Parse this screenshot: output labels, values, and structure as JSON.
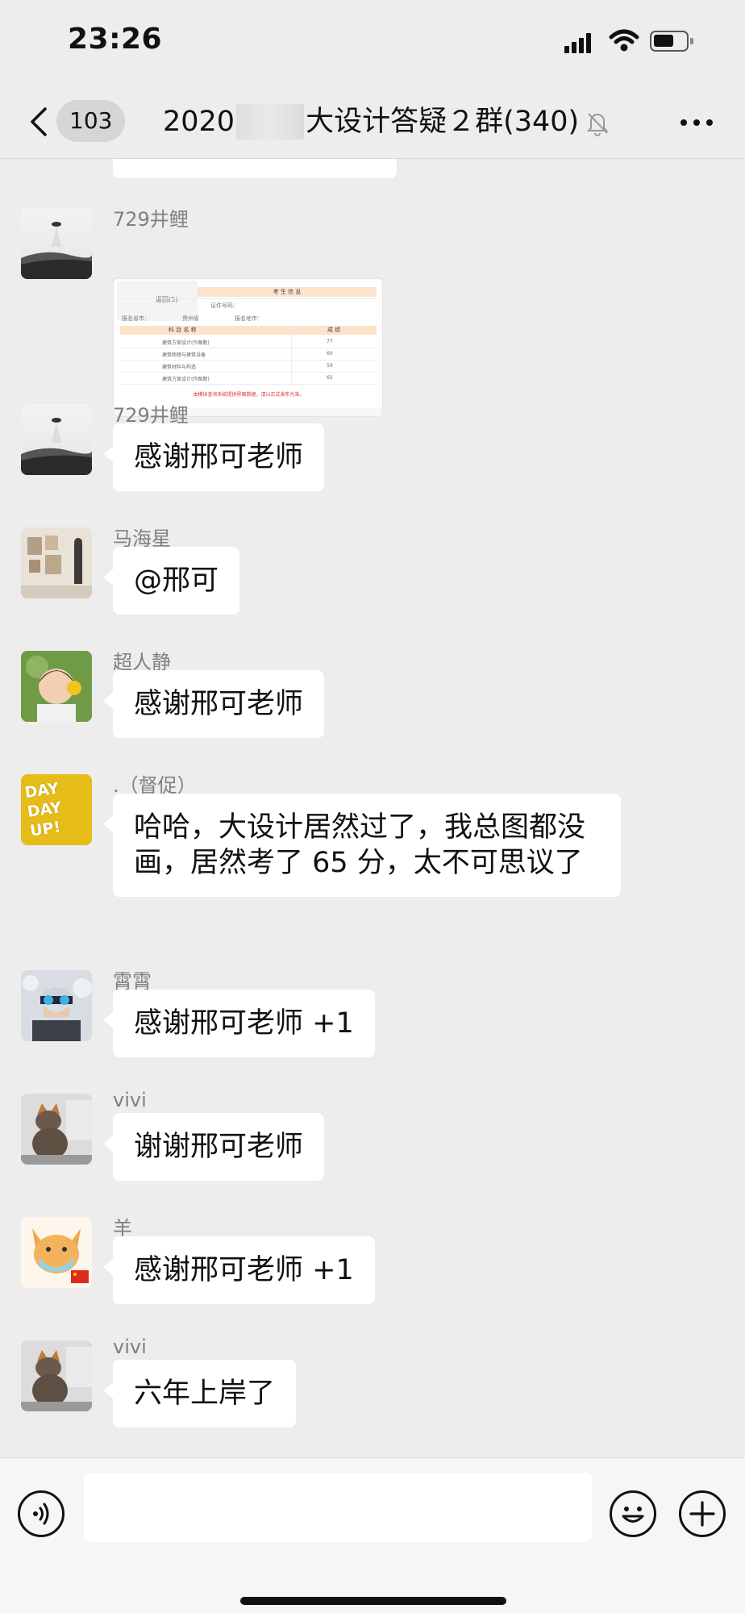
{
  "status_bar": {
    "time": "23:26"
  },
  "nav": {
    "unread_count": "103",
    "title_prefix": "2020",
    "title_suffix": "大设计答疑２群(340)",
    "icons": [
      "back-chevron-icon",
      "muted-bell-icon",
      "more-dots-icon"
    ]
  },
  "messages": [
    {
      "sender": "729井鲤",
      "type": "image",
      "avatar": "ufo-landscape-avatar"
    },
    {
      "sender": "729井鲤",
      "text": "感谢邢可老师",
      "avatar": "ufo-landscape-avatar"
    },
    {
      "sender": "马海星",
      "text": "@邢可",
      "avatar": "gallery-avatar"
    },
    {
      "sender": "超人静",
      "text": "感谢邢可老师",
      "avatar": "child-flower-avatar"
    },
    {
      "sender": ".（督促）",
      "text": "哈哈，大设计居然过了，我总图都没画，居然考了 65 分，太不可思议了",
      "avatar": "day-day-up-avatar",
      "avatar_text": [
        "DAY",
        "DAY",
        "UP!"
      ]
    },
    {
      "sender": "霄霄",
      "text": "感谢邢可老师 +1",
      "avatar": "snow-person-avatar"
    },
    {
      "sender": "vivi",
      "text": "谢谢邢可老师",
      "avatar": "cat-avatar"
    },
    {
      "sender": "羊",
      "text": "感谢邢可老师 +1",
      "avatar": "cartoon-dog-avatar"
    },
    {
      "sender": "vivi",
      "text": "六年上岸了",
      "avatar": "cat-avatar"
    }
  ],
  "score_image": {
    "header": "考 生 信 息",
    "section": "科 目 名 称",
    "score_header": "成 绩",
    "field_labels": [
      "报名省市：",
      "证件号码：",
      "报名地市："
    ],
    "field_values": [
      "贵州省"
    ],
    "button": "返回(5)",
    "subjects": [
      "建筑方案设计(作图题)",
      "建筑物理与建筑设备",
      "建筑材料与构造",
      "建筑方案设计(作图题)"
    ],
    "scores": [
      "77",
      "60",
      "59",
      "65"
    ],
    "footer": "由模拟查询系统提供界面数据，请以正式发布为准。"
  },
  "input_bar": {
    "icons": [
      "voice-icon",
      "emoji-icon",
      "plus-icon"
    ]
  },
  "colors": {
    "background": "#ededed",
    "bubble": "#ffffff",
    "sender": "#808080"
  }
}
